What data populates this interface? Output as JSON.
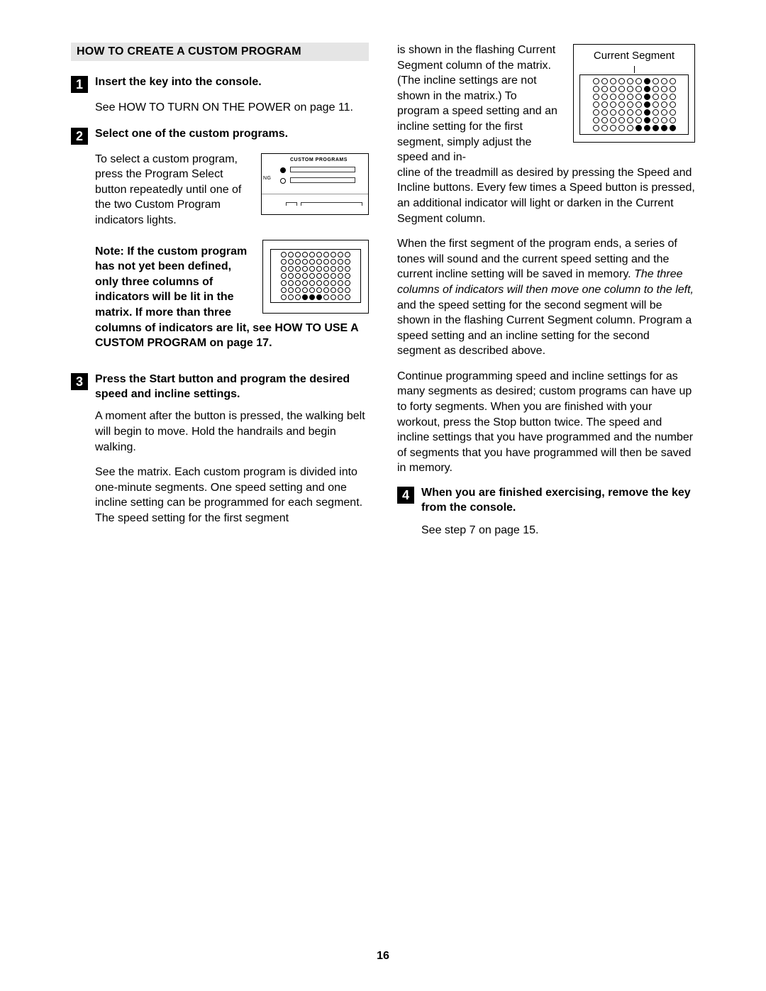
{
  "page_number": "16",
  "section_title": "HOW TO CREATE A CUSTOM PROGRAM",
  "steps": {
    "s1": {
      "num": "1",
      "title": "Insert the key into the console.",
      "p1": "See HOW TO TURN ON THE POWER on page 11."
    },
    "s2": {
      "num": "2",
      "title": "Select one of the custom programs.",
      "p1": "To select a custom program, press the Program Select button repeatedly until one of the two Custom Program indicators lights.",
      "note_bold": "Note: If the custom program has not yet been defined, only three columns of indicators will be lit in the matrix. If more than three columns of indicators are lit, see HOW TO USE A CUSTOM PROGRAM on page 17.",
      "fig_cprog_label_hdr": "CUSTOM PROGRAMS",
      "fig_cprog_label_ng": "NG"
    },
    "s3": {
      "num": "3",
      "title": "Press the Start button and program the desired speed and incline settings.",
      "p1": "A moment after the button is pressed, the walking belt will begin to move. Hold the handrails and begin walking.",
      "p2a": "See the matrix. Each custom program is divided into one-minute segments. One speed setting and one incline setting can be programmed for each segment. The speed setting for the first segment",
      "p2b": "is shown in the flashing Current Segment column of the matrix. (The incline settings are not shown in the matrix.) To program a speed setting and an incline setting for the first segment, simply adjust the speed and in",
      "p2c": "cline of the treadmill as desired by pressing the Speed and Incline buttons. Every few times a Speed button is pressed, an additional indicator will light or darken in the Current Segment column.",
      "p3a": "When the first segment of the program ends, a series of tones will sound and the current speed setting and the current incline setting will be saved in memory. ",
      "p3_italic": "The three columns of indicators will then move one column to the left,",
      "p3b": " and the speed setting for the second segment will be shown in the flashing Current Segment column. Program a speed setting and an incline setting for the second segment as described above.",
      "p4": "Continue programming speed and incline settings for as many segments as desired; custom programs can have up to forty segments. When you are finished with your workout, press the Stop button twice. The speed and incline settings that you have programmed and the number of segments that you have programmed will then be saved in memory.",
      "curseg_caption": "Current Segment"
    },
    "s4": {
      "num": "4",
      "title": "When you are finished exercising, remove the key from the console.",
      "p1": "See step 7 on page 15."
    }
  },
  "matrix_left": {
    "rows": 7,
    "cols": 10,
    "filled": [
      [
        6,
        3
      ],
      [
        6,
        4
      ],
      [
        6,
        5
      ]
    ]
  },
  "matrix_right": {
    "rows": 7,
    "cols": 10,
    "filled": [
      [
        0,
        6
      ],
      [
        1,
        6
      ],
      [
        2,
        6
      ],
      [
        3,
        6
      ],
      [
        4,
        6
      ],
      [
        5,
        6
      ],
      [
        6,
        5
      ],
      [
        6,
        6
      ],
      [
        6,
        7
      ],
      [
        6,
        8
      ],
      [
        6,
        9
      ]
    ]
  }
}
